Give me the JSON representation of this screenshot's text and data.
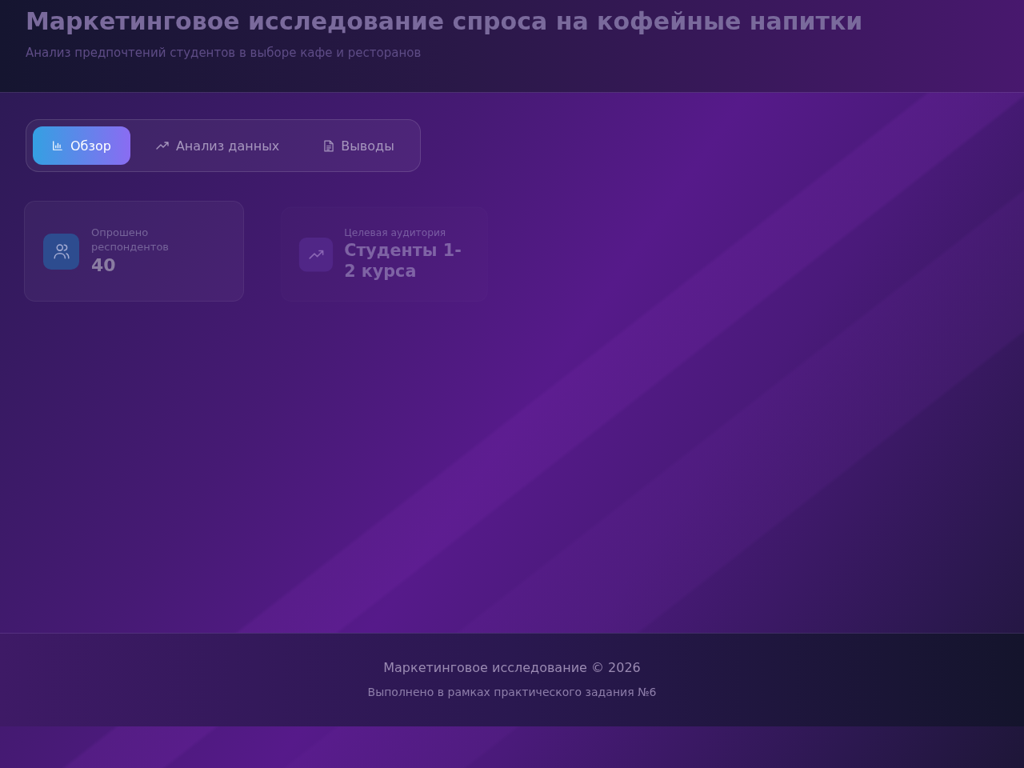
{
  "header": {
    "title": "Маркетинговое исследование спроса на кофейные напитки",
    "subtitle": "Анализ предпочтений студентов в выборе кафе и ресторанов"
  },
  "tabs": [
    {
      "kind": "bars",
      "label": "Обзор",
      "selected": true
    },
    {
      "kind": "trend",
      "label": "Анализ данных",
      "selected": false
    },
    {
      "kind": "document",
      "label": "Выводы",
      "selected": false
    }
  ],
  "stats": [
    {
      "kind": "users",
      "label": "Опрошено респондентов",
      "value": "40",
      "dimmed": false
    },
    {
      "kind": "trend",
      "label": "Целевая аудитория",
      "value": "Студенты 1-2 курса",
      "dimmed": true
    }
  ],
  "footer": {
    "copyright": "Маркетинговое исследование © 2026",
    "note": "Выполнено в рамках практического задания №6"
  }
}
